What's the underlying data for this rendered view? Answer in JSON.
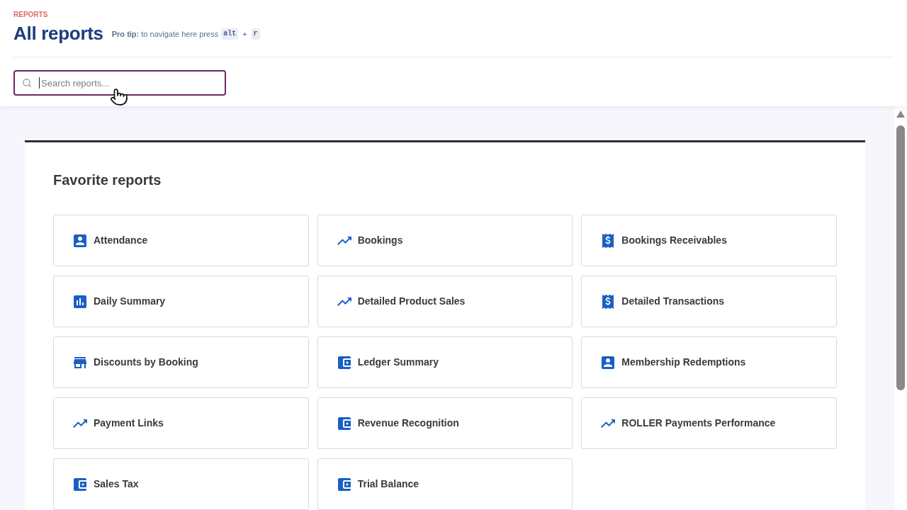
{
  "header": {
    "breadcrumb": "REPORTS",
    "title": "All reports",
    "pro_tip": {
      "text": "**Pro tip:** to navigate here press",
      "keys": [
        "alt",
        "r"
      ],
      "joiner": "+"
    }
  },
  "search": {
    "placeholder": "Search reports..."
  },
  "favorites": {
    "title": "Favorite reports",
    "reports": [
      {
        "name": "Attendance",
        "kind": "person"
      },
      {
        "name": "Bookings",
        "kind": "trend"
      },
      {
        "name": "Bookings Receivables",
        "kind": "receipt"
      },
      {
        "name": "Daily Summary",
        "kind": "chart"
      },
      {
        "name": "Detailed Product Sales",
        "kind": "trend"
      },
      {
        "name": "Detailed Transactions",
        "kind": "receipt"
      },
      {
        "name": "Discounts by Booking",
        "kind": "store"
      },
      {
        "name": "Ledger Summary",
        "kind": "wallet"
      },
      {
        "name": "Membership Redemptions",
        "kind": "person"
      },
      {
        "name": "Payment Links",
        "kind": "trend"
      },
      {
        "name": "Revenue Recognition",
        "kind": "wallet"
      },
      {
        "name": "ROLLER Payments Performance",
        "kind": "trend"
      },
      {
        "name": "Sales Tax",
        "kind": "wallet"
      },
      {
        "name": "Trial Balance",
        "kind": "wallet"
      }
    ]
  }
}
